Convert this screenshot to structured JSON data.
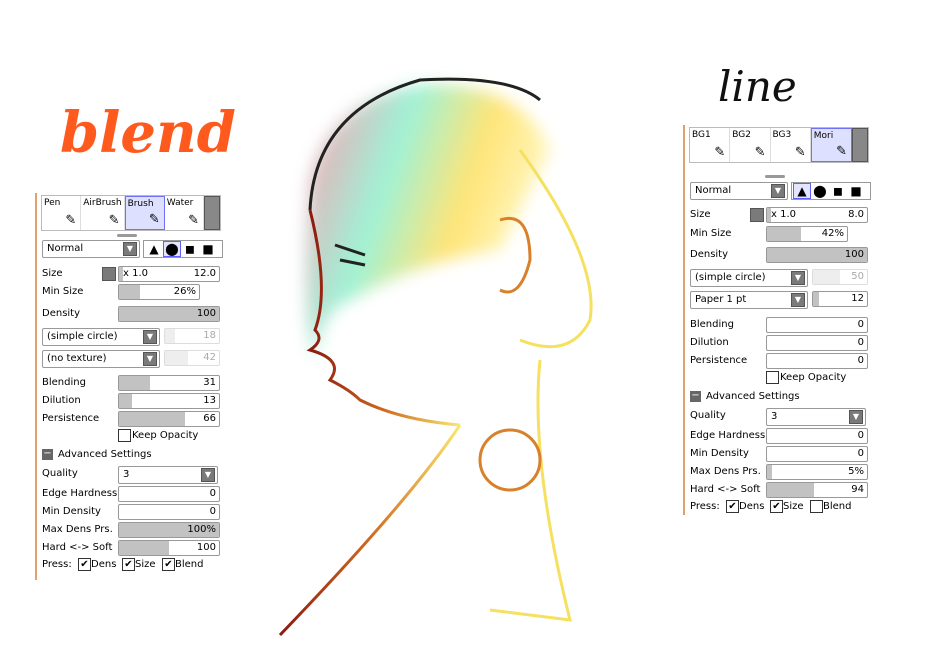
{
  "titles": {
    "left": "blend",
    "right": "line"
  },
  "colors": {
    "left_title": "#ff5a1e",
    "right_title": "#111111"
  },
  "left": {
    "tools": [
      {
        "label": "Pen",
        "icon": "pencil-icon"
      },
      {
        "label": "AirBrush",
        "icon": "airbrush-icon"
      },
      {
        "label": "Brush",
        "icon": "brush-icon",
        "selected": true
      },
      {
        "label": "Water",
        "icon": "water-icon"
      }
    ],
    "mode": "Normal",
    "shape_selected": 1,
    "size_mult": "x 1.0",
    "size": "12.0",
    "min_size": "26%",
    "min_size_pct": 26,
    "density": "100",
    "density_pct": 100,
    "shape": "(simple circle)",
    "shape_val": "18",
    "shape_pct": 18,
    "texture": "(no texture)",
    "texture_val": "42",
    "texture_pct": 42,
    "blending": "31",
    "dilution": "13",
    "persistence": "66",
    "keep_opacity": "Keep Opacity",
    "keep_opacity_checked": false,
    "advanced": "Advanced Settings",
    "quality": "3",
    "edge_hardness": "0",
    "min_density": "0",
    "max_dens_prs": "100%",
    "max_dens_pct": 100,
    "hard_soft": "100",
    "press": {
      "label": "Press:",
      "dens": "Dens",
      "size": "Size",
      "blend": "Blend",
      "dens_checked": true,
      "size_checked": true,
      "blend_checked": true
    }
  },
  "right": {
    "tools": [
      {
        "label": "BG1",
        "icon": "pencil-icon"
      },
      {
        "label": "BG2",
        "icon": "pen-icon"
      },
      {
        "label": "BG3",
        "icon": "pen-icon"
      },
      {
        "label": "Mori",
        "icon": "pen-icon",
        "selected": true
      }
    ],
    "mode": "Normal",
    "shape_selected": 0,
    "size_mult": "x 1.0",
    "size": "8.0",
    "min_size": "42%",
    "min_size_pct": 42,
    "density": "100",
    "density_pct": 100,
    "shape": "(simple circle)",
    "shape_val": "50",
    "shape_pct": 50,
    "texture": "Paper 1 pt",
    "texture_val": "12",
    "texture_pct": 12,
    "blending": "0",
    "dilution": "0",
    "persistence": "0",
    "keep_opacity": "Keep Opacity",
    "keep_opacity_checked": false,
    "advanced": "Advanced Settings",
    "quality": "3",
    "edge_hardness": "0",
    "min_density": "0",
    "max_dens_prs": "5%",
    "max_dens_pct": 5,
    "hard_soft": "94",
    "press": {
      "label": "Press:",
      "dens": "Dens",
      "size": "Size",
      "blend": "Blend",
      "dens_checked": true,
      "size_checked": true,
      "blend_checked": false
    }
  },
  "labels": {
    "size": "Size",
    "min_size": "Min Size",
    "density": "Density",
    "blending": "Blending",
    "dilution": "Dilution",
    "persistence": "Persistence",
    "quality": "Quality",
    "edge_hardness": "Edge Hardness",
    "min_density": "Min Density",
    "max_dens_prs": "Max Dens Prs.",
    "hard_soft": "Hard <-> Soft"
  }
}
